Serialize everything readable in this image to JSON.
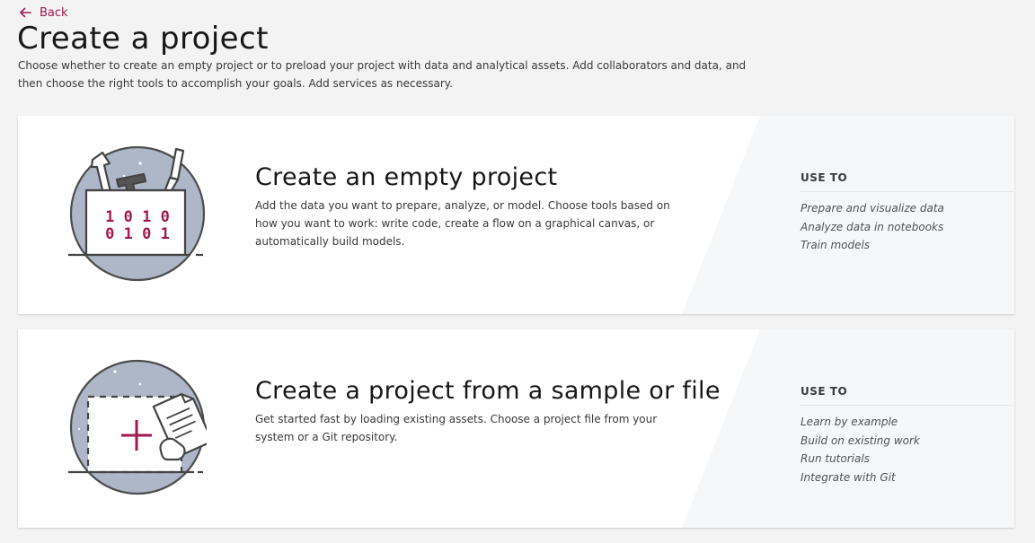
{
  "header": {
    "back_label": "Back",
    "title": "Create a project",
    "description": "Choose whether to create an empty project or to preload your project with data and analytical assets. Add collaborators and data, and then choose the right tools to accomplish your goals. Add services as necessary."
  },
  "cards": [
    {
      "id": "empty",
      "title": "Create an empty project",
      "description": "Add the data you want to prepare, analyze, or model. Choose tools based on how you want to work: write code, create a flow on a graphical canvas, or automatically build models.",
      "illustration": "toolbox-icon",
      "illustration_text": [
        "1 0 1 0",
        "0 1 0 1"
      ],
      "use_to_heading": "USE TO",
      "use_to": [
        "Prepare and visualize data",
        "Analyze data in notebooks",
        "Train models"
      ]
    },
    {
      "id": "sample",
      "title": "Create a project from a sample or file",
      "description": "Get started fast by loading existing assets. Choose a project file from your system or a Git repository.",
      "illustration": "file-upload-icon",
      "use_to_heading": "USE TO",
      "use_to": [
        "Learn by example",
        "Build on existing work",
        "Run tutorials",
        "Integrate with Git"
      ]
    }
  ],
  "colors": {
    "accent": "#a11950",
    "background": "#f3f3f3",
    "card": "#ffffff",
    "illustration_fill": "#adb7c8"
  },
  "icons": {
    "back": "arrow-left-icon"
  }
}
